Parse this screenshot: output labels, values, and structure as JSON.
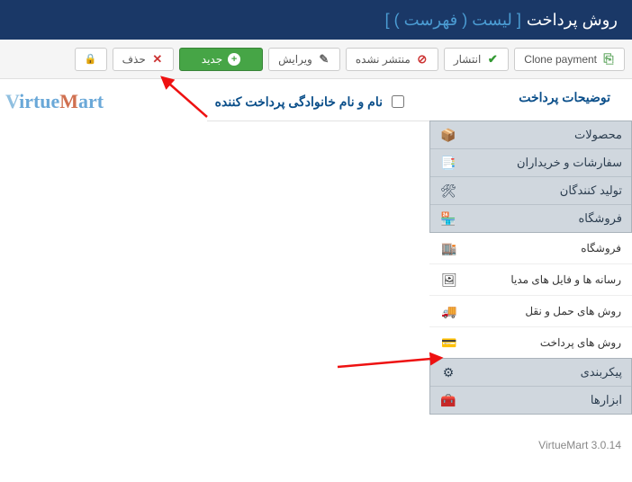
{
  "header": {
    "title": "روش پرداخت",
    "context": "[ لیست ( فهرست ) ]"
  },
  "toolbar": {
    "clone": "Clone payment",
    "publish": "انتشار",
    "unpublish": "منتشر نشده",
    "edit": "ویرایش",
    "new": "جدید",
    "delete": "حذف"
  },
  "columns": {
    "name": "نام و نام خانوادگی پرداخت کننده",
    "desc": "توضیحات پرداخت"
  },
  "logo": {
    "v": "V",
    "mid": "irtue",
    "m": "M",
    "end": "art"
  },
  "sidebar": {
    "top": [
      {
        "label": "محصولات",
        "icon": "📦"
      },
      {
        "label": "سفارشات و خریداران",
        "icon": "📑"
      },
      {
        "label": "تولید کنندگان",
        "icon": "🛠"
      },
      {
        "label": "فروشگاه",
        "icon": "🏪"
      }
    ],
    "sub": [
      {
        "label": "فروشگاه",
        "icon": "🏬"
      },
      {
        "label": "رسانه ها و فایل های مدیا",
        "icon": "🖼"
      },
      {
        "label": "روش های حمل و نقل",
        "icon": "🚚"
      },
      {
        "label": "روش های پرداخت",
        "icon": "💳"
      }
    ],
    "bottom": [
      {
        "label": "پیکربندی",
        "icon": "⚙"
      },
      {
        "label": "ابزارها",
        "icon": "🧰"
      }
    ]
  },
  "version": "VirtueMart 3.0.14"
}
